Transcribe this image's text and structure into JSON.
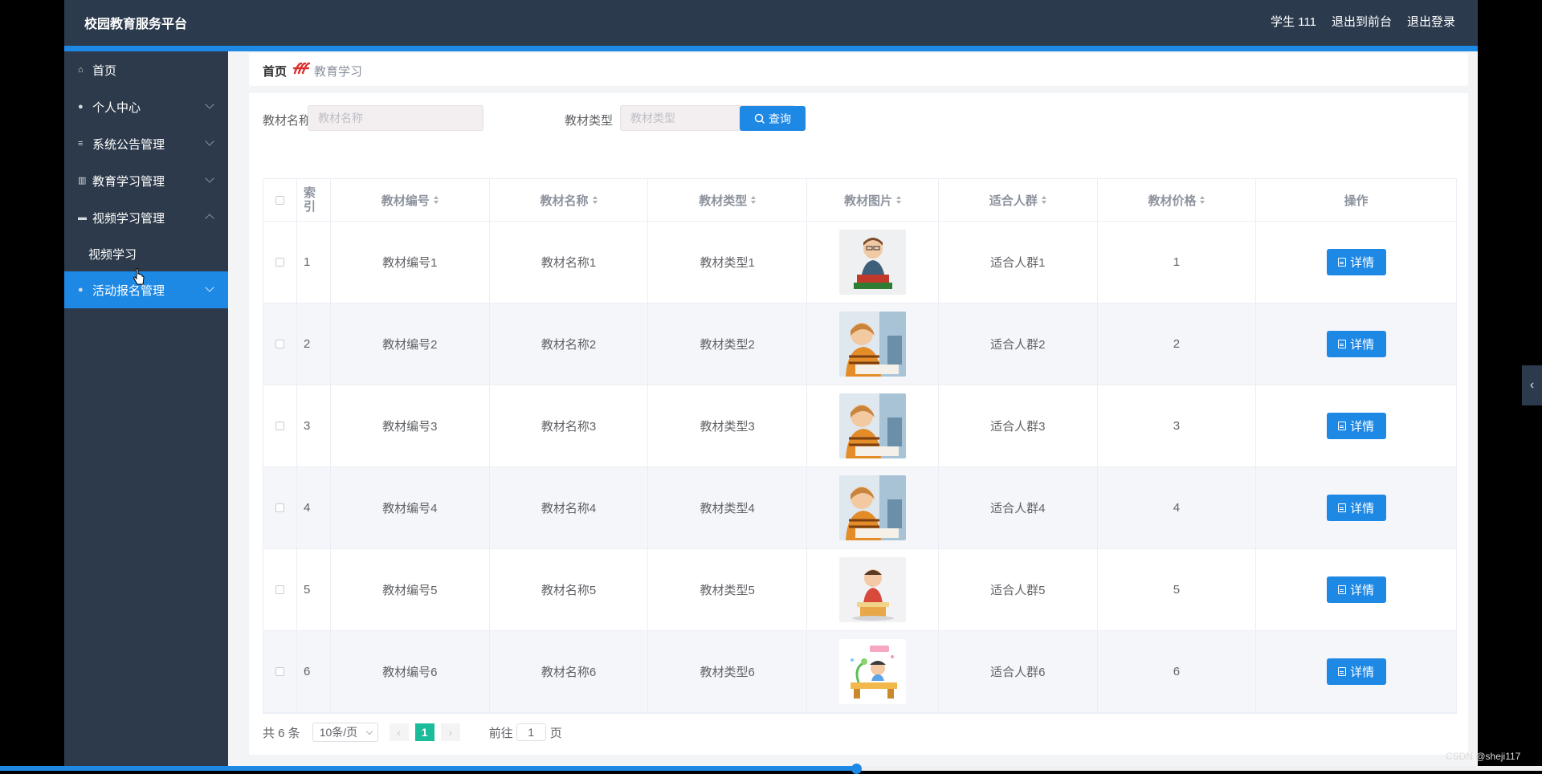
{
  "header": {
    "brand": "校园教育服务平台",
    "user": "学生 111",
    "back_to_front": "退出到前台",
    "logout": "退出登录"
  },
  "sidebar": {
    "items": [
      {
        "label": "首页",
        "icon": "home-icon"
      },
      {
        "label": "个人中心",
        "icon": "user-icon"
      },
      {
        "label": "系统公告管理",
        "icon": "list-icon"
      },
      {
        "label": "教育学习管理",
        "icon": "chart-icon"
      },
      {
        "label": "视频学习管理",
        "icon": "message-icon"
      },
      {
        "label": "活动报名管理",
        "icon": "user-icon"
      }
    ],
    "submenu_label": "视频学习"
  },
  "breadcrumb": {
    "home": "首页",
    "separator": "𝓭",
    "current": "教育学习"
  },
  "search": {
    "name_label": "教材名称",
    "name_placeholder": "教材名称",
    "type_label": "教材类型",
    "type_placeholder": "教材类型",
    "button": "查询"
  },
  "table": {
    "headers": [
      "索引",
      "教材编号",
      "教材名称",
      "教材类型",
      "教材图片",
      "适合人群",
      "教材价格",
      "操作"
    ],
    "rows": [
      {
        "index": "1",
        "code": "教材编号1",
        "name": "教材名称1",
        "type": "教材类型1",
        "audience": "适合人群1",
        "price": "1",
        "action": "详情"
      },
      {
        "index": "2",
        "code": "教材编号2",
        "name": "教材名称2",
        "type": "教材类型2",
        "audience": "适合人群2",
        "price": "2",
        "action": "详情"
      },
      {
        "index": "3",
        "code": "教材编号3",
        "name": "教材名称3",
        "type": "教材类型3",
        "audience": "适合人群3",
        "price": "3",
        "action": "详情"
      },
      {
        "index": "4",
        "code": "教材编号4",
        "name": "教材名称4",
        "type": "教材类型4",
        "audience": "适合人群4",
        "price": "4",
        "action": "详情"
      },
      {
        "index": "5",
        "code": "教材编号5",
        "name": "教材名称5",
        "type": "教材类型5",
        "audience": "适合人群5",
        "price": "5",
        "action": "详情"
      },
      {
        "index": "6",
        "code": "教材编号6",
        "name": "教材名称6",
        "type": "教材类型6",
        "audience": "适合人群6",
        "price": "6",
        "action": "详情"
      }
    ]
  },
  "pagination": {
    "total": "共 6 条",
    "page_size": "10条/页",
    "current_page": "1",
    "goto_prefix": "前往",
    "goto_value": "1",
    "goto_suffix": "页"
  },
  "watermark": "CSDN @sheji117",
  "video_progress": 0.555,
  "colors": {
    "header_bg": "#2b3a4d",
    "accent": "#1e88e5",
    "sidebar_bg": "#2d3a4b",
    "active_page": "#1bbc9b"
  }
}
